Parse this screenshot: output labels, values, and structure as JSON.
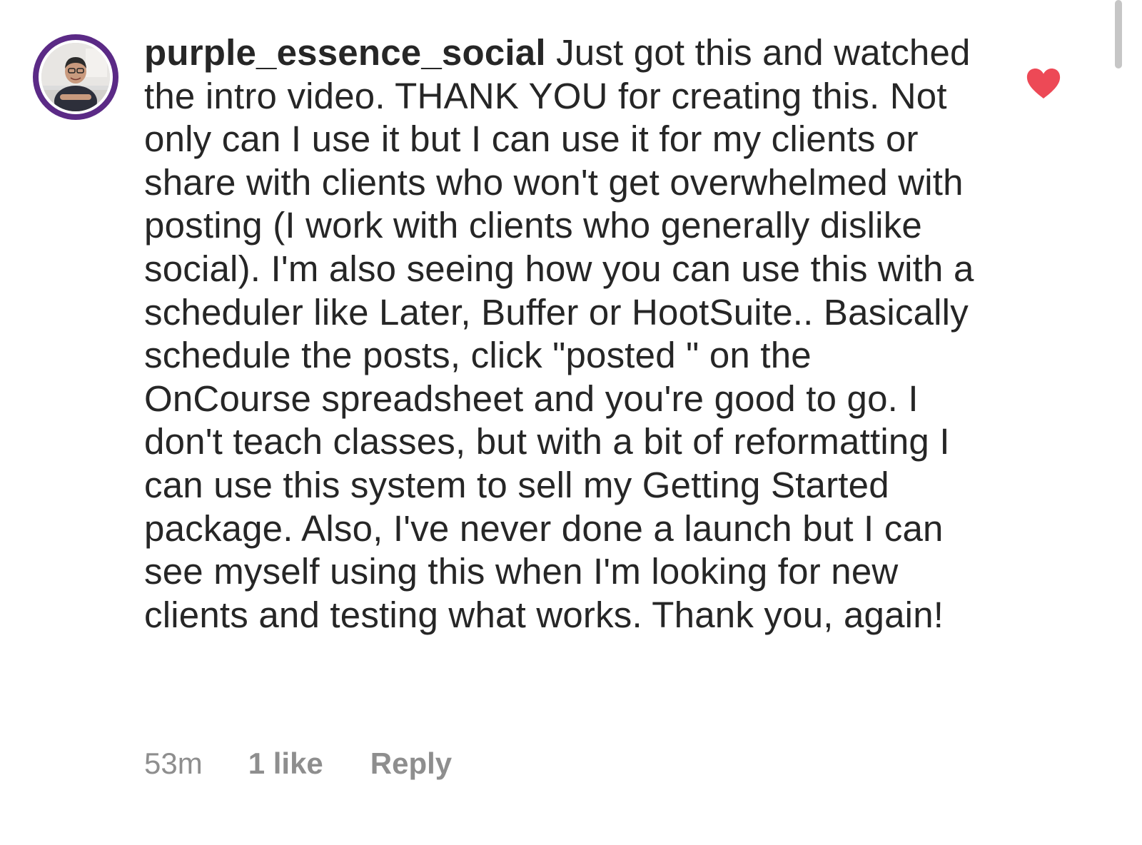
{
  "comment": {
    "username": "purple_essence_social",
    "text": "Just got this and watched the intro video. THANK YOU for creating this. Not only can I use it but I can use it for my clients or share with clients who won't get overwhelmed with posting (I work with clients who generally dislike social). I'm also seeing how you can use this with a scheduler like Later, Buffer or HootSuite.. Basically schedule the posts, click \"posted \" on the OnCourse spreadsheet and you're good to go. I don't teach classes, but with a bit of reformatting I can use this system to sell my Getting Started package. Also, I've never done a launch but I can see myself using this when I'm looking for new clients and testing what works. Thank you, again!",
    "timestamp": "53m",
    "likes": "1 like",
    "reply_label": "Reply",
    "liked": true,
    "heart_icon": "heart-filled-icon",
    "heart_color": "#ed4956",
    "avatar_ring_color": "#5b2a86"
  }
}
